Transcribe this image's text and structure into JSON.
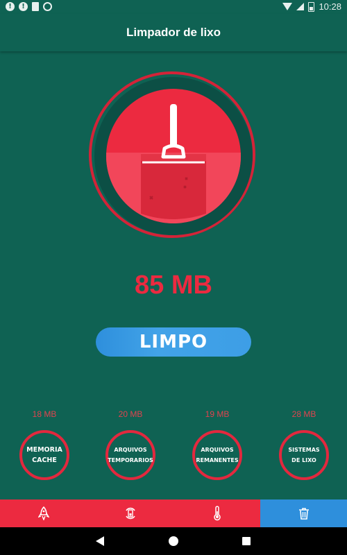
{
  "status_bar": {
    "time": "10:28",
    "icons": [
      "alert-icon",
      "alert-icon",
      "sd-card-icon",
      "sync-icon",
      "wifi-icon",
      "signal-icon",
      "battery-icon"
    ]
  },
  "app_bar": {
    "title": "Limpador de lixo"
  },
  "cleaner": {
    "icon": "broom-icon",
    "junk_size": "85 MB",
    "clean_button_label": "LIMPO"
  },
  "categories": [
    {
      "size": "18 MB",
      "label": "MEMORIA\nCACHE"
    },
    {
      "size": "20 MB",
      "label": "ARQUIVOS\nTEMPORARIOS"
    },
    {
      "size": "19 MB",
      "label": "ARQUIVOS\nREMANENTES"
    },
    {
      "size": "28 MB",
      "label": "SISTEMAS\nDE LIXO"
    }
  ],
  "bottom_nav": {
    "items": [
      "rocket-icon",
      "battery-cycle-icon",
      "thermometer-icon",
      "trash-icon"
    ],
    "active_index": 3
  },
  "colors": {
    "background": "#0f6253",
    "accent_red": "#ec2a40",
    "accent_blue": "#2e8fdc"
  }
}
